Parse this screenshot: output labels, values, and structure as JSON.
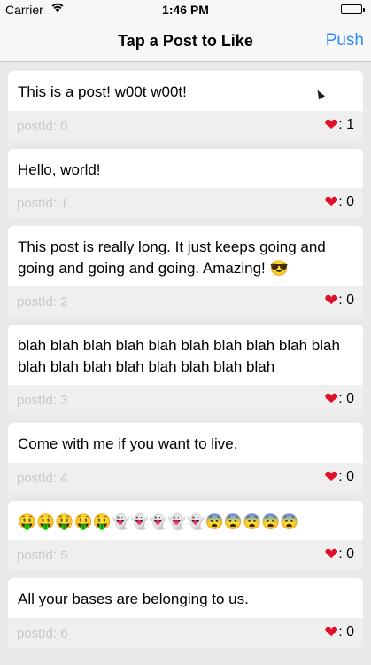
{
  "status_bar": {
    "carrier": "Carrier",
    "wifi_icon": "wifi-icon",
    "time": "1:46 PM",
    "battery_icon": "battery-icon"
  },
  "nav": {
    "title": "Tap a Post to Like",
    "push_label": "Push"
  },
  "posts": [
    {
      "text": "This is a post! w00t w00t!",
      "post_id_label": "postId: 0",
      "likes": ": 1"
    },
    {
      "text": "Hello, world!",
      "post_id_label": "postId: 1",
      "likes": ": 0"
    },
    {
      "text": "This post is really long. It just keeps going and going and going and going. Amazing! 😎",
      "post_id_label": "postId: 2",
      "likes": ": 0"
    },
    {
      "text": "blah blah blah blah blah blah blah blah blah blah blah blah blah blah blah blah blah blah",
      "post_id_label": "postId: 3",
      "likes": ": 0"
    },
    {
      "text": "Come with me if you want to live.",
      "post_id_label": "postId: 4",
      "likes": ": 0"
    },
    {
      "text": "🤑🤑🤑🤑🤑👻👻👻👻👻😨😨😨😨😨",
      "post_id_label": "postId: 5",
      "likes": ": 0"
    },
    {
      "text": "All your bases are belonging to us.",
      "post_id_label": "postId: 6",
      "likes": ": 0"
    }
  ],
  "colors": {
    "accent": "#2f8cf6",
    "heart": "#e0102a",
    "background": "#e9e9ea",
    "footer": "#efefef",
    "post_id_text": "#c8c8c8"
  },
  "icons": {
    "heart": "heart-icon",
    "cursor": "mouse-cursor-icon"
  }
}
